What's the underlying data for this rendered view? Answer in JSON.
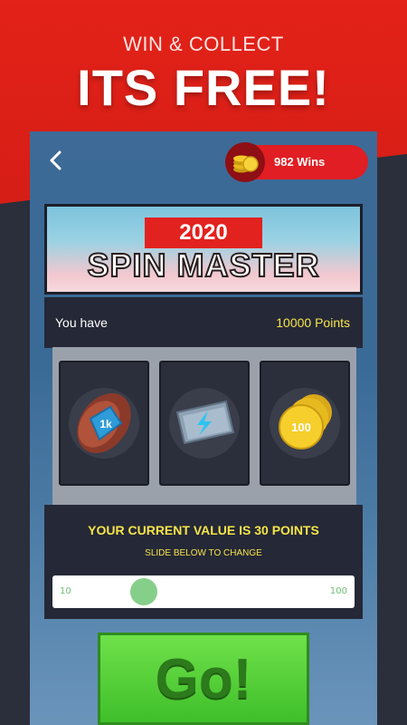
{
  "promo": {
    "tagline": "WIN & COLLECT",
    "headline": "ITS FREE!"
  },
  "header": {
    "back_icon": "chevron-left-icon",
    "wins_label": "982 Wins",
    "coin_icon": "coin-stack-icon"
  },
  "banner": {
    "year": "2020",
    "title": "SPIN MASTER"
  },
  "points": {
    "label": "You have",
    "value": "10000 Points"
  },
  "slots": [
    {
      "icon": "1k-gem-icon",
      "text": "1k"
    },
    {
      "icon": "lightning-ticket-icon"
    },
    {
      "icon": "100-coin-icon",
      "text": "100"
    }
  ],
  "value_panel": {
    "title": "YOUR CURRENT VALUE IS 30 POINTS",
    "subtitle": "SLIDE BELOW TO CHANGE",
    "min_label": "10",
    "max_label": "100",
    "current": 30,
    "min": 10,
    "max": 100
  },
  "go_button": {
    "label": "Go!"
  },
  "colors": {
    "accent_red": "#e01e23",
    "points_yellow": "#f6e44a",
    "go_green": "#3fbf2a",
    "panel_dark": "#252836"
  }
}
